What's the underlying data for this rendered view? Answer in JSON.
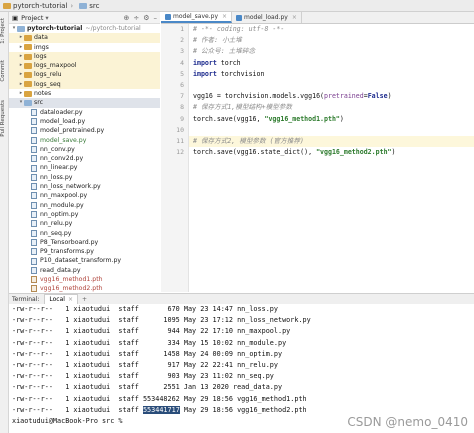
{
  "titlebar": {
    "project": "pytorch-tutorial",
    "folder": "src"
  },
  "leftstrip": {
    "project_label": "1: Project",
    "commit_label": "Commit",
    "pull_label": "Pull Requests"
  },
  "project_panel": {
    "header": "Project"
  },
  "tree": [
    {
      "label": "pytorch-tutorial",
      "suffix": "~/pytorch-tutorial",
      "type": "folder-root",
      "indent": 0,
      "arrow": "▾"
    },
    {
      "label": "data",
      "type": "folder",
      "indent": 1,
      "arrow": "▸",
      "hl": true
    },
    {
      "label": "imgs",
      "type": "folder",
      "indent": 1,
      "arrow": "▸"
    },
    {
      "label": "logs",
      "type": "folder",
      "indent": 1,
      "arrow": "▸",
      "hl": true
    },
    {
      "label": "logs_maxpool",
      "type": "folder",
      "indent": 1,
      "arrow": "▸",
      "hl": true
    },
    {
      "label": "logs_relu",
      "type": "folder",
      "indent": 1,
      "arrow": "▸",
      "hl": true
    },
    {
      "label": "logs_seq",
      "type": "folder",
      "indent": 1,
      "arrow": "▸",
      "hl": true
    },
    {
      "label": "notes",
      "type": "folder",
      "indent": 1,
      "arrow": "▸"
    },
    {
      "label": "src",
      "type": "folder",
      "indent": 1,
      "arrow": "▾",
      "sel": true
    },
    {
      "label": "dataloader.py",
      "type": "py",
      "indent": 2
    },
    {
      "label": "model_load.py",
      "type": "py",
      "indent": 2
    },
    {
      "label": "model_pretrained.py",
      "type": "py",
      "indent": 2
    },
    {
      "label": "model_save.py",
      "type": "py",
      "indent": 2,
      "color": "green"
    },
    {
      "label": "nn_conv.py",
      "type": "py",
      "indent": 2
    },
    {
      "label": "nn_conv2d.py",
      "type": "py",
      "indent": 2
    },
    {
      "label": "nn_linear.py",
      "type": "py",
      "indent": 2
    },
    {
      "label": "nn_loss.py",
      "type": "py",
      "indent": 2
    },
    {
      "label": "nn_loss_network.py",
      "type": "py",
      "indent": 2
    },
    {
      "label": "nn_maxpool.py",
      "type": "py",
      "indent": 2
    },
    {
      "label": "nn_module.py",
      "type": "py",
      "indent": 2
    },
    {
      "label": "nn_optim.py",
      "type": "py",
      "indent": 2
    },
    {
      "label": "nn_relu.py",
      "type": "py",
      "indent": 2
    },
    {
      "label": "nn_seq.py",
      "type": "py",
      "indent": 2
    },
    {
      "label": "P8_Tensorboard.py",
      "type": "py",
      "indent": 2
    },
    {
      "label": "P9_transforms.py",
      "type": "py",
      "indent": 2
    },
    {
      "label": "P10_dataset_transform.py",
      "type": "py",
      "indent": 2
    },
    {
      "label": "read_data.py",
      "type": "py",
      "indent": 2
    },
    {
      "label": "vgg16_method1.pth",
      "type": "pth",
      "indent": 2,
      "color": "red"
    },
    {
      "label": "vgg16_method2.pth",
      "type": "pth",
      "indent": 2,
      "color": "red"
    }
  ],
  "tabs": [
    {
      "label": "model_save.py",
      "active": true
    },
    {
      "label": "model_load.py",
      "active": false
    }
  ],
  "code_lines": [
    {
      "n": "1",
      "parts": [
        {
          "t": "# -*- coding: utf-8 -*-",
          "c": "cmt"
        }
      ]
    },
    {
      "n": "2",
      "parts": [
        {
          "t": "# 作者: 小土堆",
          "c": "cmt"
        }
      ]
    },
    {
      "n": "3",
      "parts": [
        {
          "t": "# 公众号: 土堆碎念",
          "c": "cmt"
        }
      ]
    },
    {
      "n": "4",
      "parts": [
        {
          "t": "import",
          "c": "kw"
        },
        {
          "t": " torch",
          "c": ""
        }
      ]
    },
    {
      "n": "5",
      "parts": [
        {
          "t": "import",
          "c": "kw"
        },
        {
          "t": " torchvision",
          "c": ""
        }
      ]
    },
    {
      "n": "6",
      "parts": []
    },
    {
      "n": "7",
      "parts": [
        {
          "t": "vgg16 = torchvision.models.vgg16(",
          "c": ""
        },
        {
          "t": "pretrained",
          "c": "param"
        },
        {
          "t": "=",
          "c": ""
        },
        {
          "t": "False",
          "c": "kwv"
        },
        {
          "t": ")",
          "c": ""
        }
      ]
    },
    {
      "n": "8",
      "parts": [
        {
          "t": "# 保存方式1,模型结构+模型参数",
          "c": "cmt"
        }
      ]
    },
    {
      "n": "9",
      "parts": [
        {
          "t": "torch.save(vgg16, ",
          "c": ""
        },
        {
          "t": "\"vgg16_method1.pth\"",
          "c": "str"
        },
        {
          "t": ")",
          "c": ""
        }
      ]
    },
    {
      "n": "10",
      "parts": []
    },
    {
      "n": "11",
      "parts": [
        {
          "t": "# 保存方式2, 模型参数 (官方推荐)",
          "c": "cmt"
        }
      ],
      "cur": true
    },
    {
      "n": "12",
      "parts": [
        {
          "t": "torch.save(vgg16.state_dict(), ",
          "c": ""
        },
        {
          "t": "\"vgg16_method2.pth\"",
          "c": "str"
        },
        {
          "t": ")",
          "c": ""
        }
      ]
    }
  ],
  "terminal": {
    "header": "Terminal:",
    "tab_label": "Local",
    "lines": [
      "-rw-r--r--   1 xiaotudui  staff       670 May 23 14:47 nn_loss.py",
      "-rw-r--r--   1 xiaotudui  staff      1095 May 23 17:12 nn_loss_network.py",
      "-rw-r--r--   1 xiaotudui  staff       944 May 22 17:10 nn_maxpool.py",
      "-rw-r--r--   1 xiaotudui  staff       334 May 15 10:02 nn_module.py",
      "-rw-r--r--   1 xiaotudui  staff      1458 May 24 00:09 nn_optim.py",
      "-rw-r--r--   1 xiaotudui  staff       917 May 22 22:41 nn_relu.py",
      "-rw-r--r--   1 xiaotudui  staff       903 May 23 11:02 nn_seq.py",
      "-rw-r--r--   1 xiaotudui  staff      2551 Jan 13 2020 read_data.py",
      "-rw-r--r--   1 xiaotudui  staff 553448262 May 29 18:56 vgg16_method1.pth"
    ],
    "last_line_prefix": "-rw-r--r--   1 xiaotudui  staff ",
    "last_line_selected": "553441717",
    "last_line_suffix": " May 29 18:56 vgg16_method2.pth",
    "prompt": "xiaotudui@MacBook-Pro src % "
  },
  "watermark": "CSDN @nemo_0410",
  "colors": {
    "accent": "#4a88c7",
    "highlight": "#fbf3d5",
    "selection": "#2a4d7a"
  }
}
